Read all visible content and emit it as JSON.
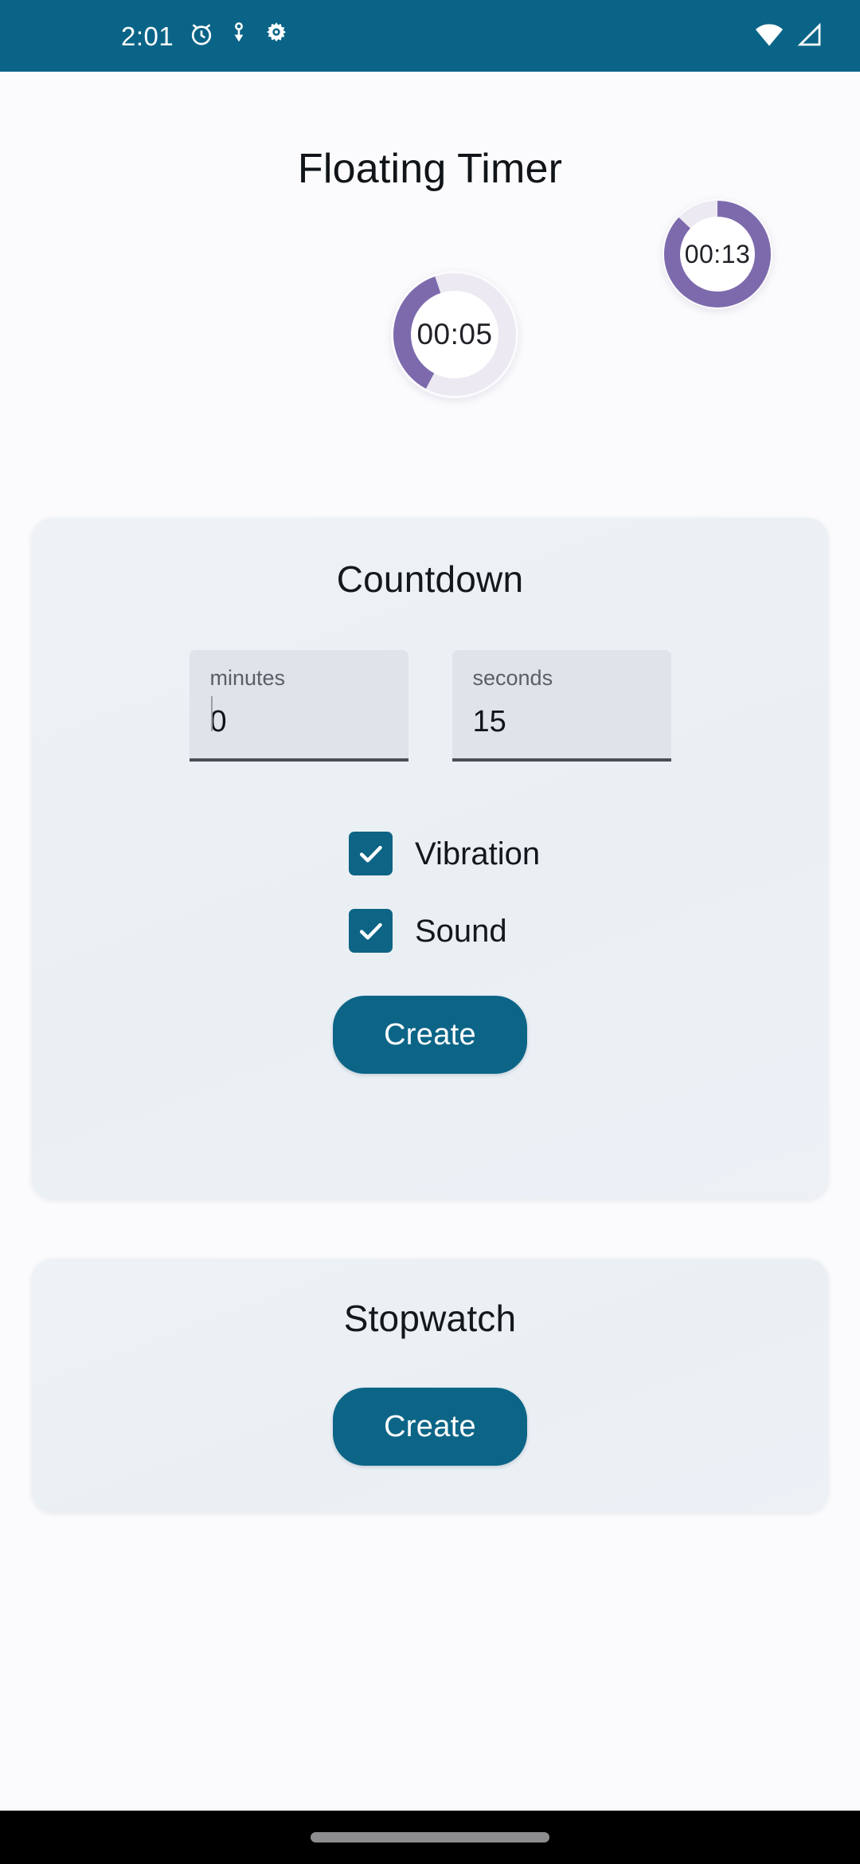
{
  "status_bar": {
    "time": "2:01",
    "background": "#0a6487",
    "icons": [
      "alarm-icon",
      "bug-icon",
      "gear-icon",
      "wifi-icon",
      "cellular-signal-icon"
    ]
  },
  "app": {
    "title": "Floating Timer",
    "accent_teal": "#0c6587",
    "accent_purple": "#7d6aad",
    "track_color": "#ece9f2",
    "page_background": "#fbfbfd"
  },
  "floating_bubbles": [
    {
      "name": "countdown-bubble-a",
      "time": "00:05",
      "progress": 0.37,
      "start_angle": -152,
      "size": 160
    },
    {
      "name": "countdown-bubble-b",
      "time": "00:13",
      "progress": 0.87,
      "start_angle": 0,
      "size": 138
    }
  ],
  "countdown_card": {
    "title": "Countdown",
    "fields": [
      {
        "label": "minutes",
        "value": "0"
      },
      {
        "label": "seconds",
        "value": "15"
      }
    ],
    "options": [
      {
        "label": "Vibration",
        "checked": true
      },
      {
        "label": "Sound",
        "checked": true
      }
    ],
    "create_label": "Create"
  },
  "stopwatch_card": {
    "title": "Stopwatch",
    "create_label": "Create"
  },
  "nav_bar": {
    "gesture_pill": "home-gesture-pill"
  }
}
